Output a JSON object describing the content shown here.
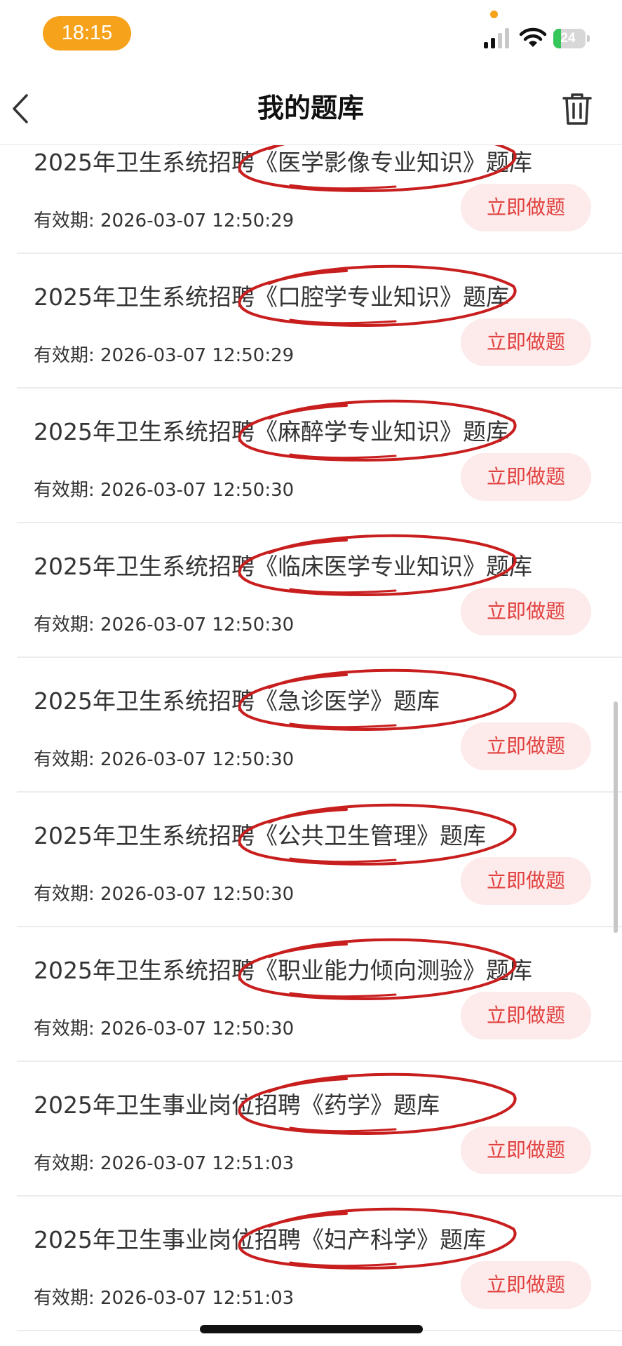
{
  "status_bar": {
    "time": "18:15",
    "battery_level": "24",
    "battery_fraction": 0.24
  },
  "header": {
    "title": "我的题库",
    "back_icon": "chevron-left-icon",
    "action_icon": "trash-icon"
  },
  "colors": {
    "accent": "#e0413f",
    "button_bg": "#fdeaea",
    "annotation": "#c81e1e",
    "time_pill": "#f7a21b",
    "battery": "#35c759"
  },
  "list": {
    "validity_label": "有效期: ",
    "button_label": "立即做题",
    "items": [
      {
        "title": "2025年卫生系统招聘《医学影像专业知识》题库",
        "validity": "2026-03-07 12:50:29"
      },
      {
        "title": "2025年卫生系统招聘《口腔学专业知识》题库",
        "validity": "2026-03-07 12:50:29"
      },
      {
        "title": "2025年卫生系统招聘《麻醉学专业知识》题库",
        "validity": "2026-03-07 12:50:30"
      },
      {
        "title": "2025年卫生系统招聘《临床医学专业知识》题库",
        "validity": "2026-03-07 12:50:30"
      },
      {
        "title": "2025年卫生系统招聘《急诊医学》题库",
        "validity": "2026-03-07 12:50:30"
      },
      {
        "title": "2025年卫生系统招聘《公共卫生管理》题库",
        "validity": "2026-03-07 12:50:30"
      },
      {
        "title": "2025年卫生系统招聘《职业能力倾向测验》题库",
        "validity": "2026-03-07 12:50:30"
      },
      {
        "title": "2025年卫生事业岗位招聘《药学》题库",
        "validity": "2026-03-07 12:51:03"
      },
      {
        "title": "2025年卫生事业岗位招聘《妇产科学》题库",
        "validity": "2026-03-07 12:51:03"
      }
    ]
  }
}
